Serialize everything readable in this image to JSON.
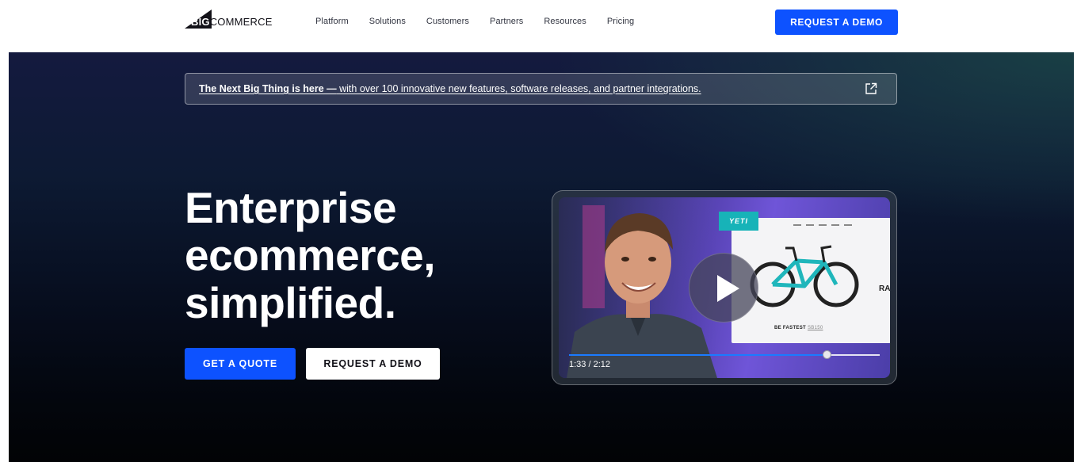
{
  "header": {
    "logo_big": "BIG",
    "logo_rest": "COMMERCE",
    "nav": [
      "Platform",
      "Solutions",
      "Customers",
      "Partners",
      "Resources",
      "Pricing"
    ],
    "cta_label": "REQUEST A DEMO"
  },
  "banner": {
    "lead": "The Next Big Thing is here —",
    "text": " with over 100 innovative new features, software releases, and partner integrations.",
    "icon": "external-link-icon"
  },
  "hero": {
    "headline_line1": "Enterprise",
    "headline_line2": "ecommerce,",
    "headline_line3": "simplified.",
    "quote_button": "GET A QUOTE",
    "demo_button": "REQUEST A DEMO"
  },
  "video": {
    "brand_tag": "YETI",
    "caption_lead": "BE FASTEST",
    "caption_model": "SB150",
    "side_text": "RA",
    "timecode": "1:33 / 2:12",
    "progress_fraction": 0.83,
    "play_icon": "play-icon"
  },
  "colors": {
    "brand_blue": "#0d52ff",
    "hero_dark": "#0d1a33",
    "progress": "#1a7bff"
  }
}
